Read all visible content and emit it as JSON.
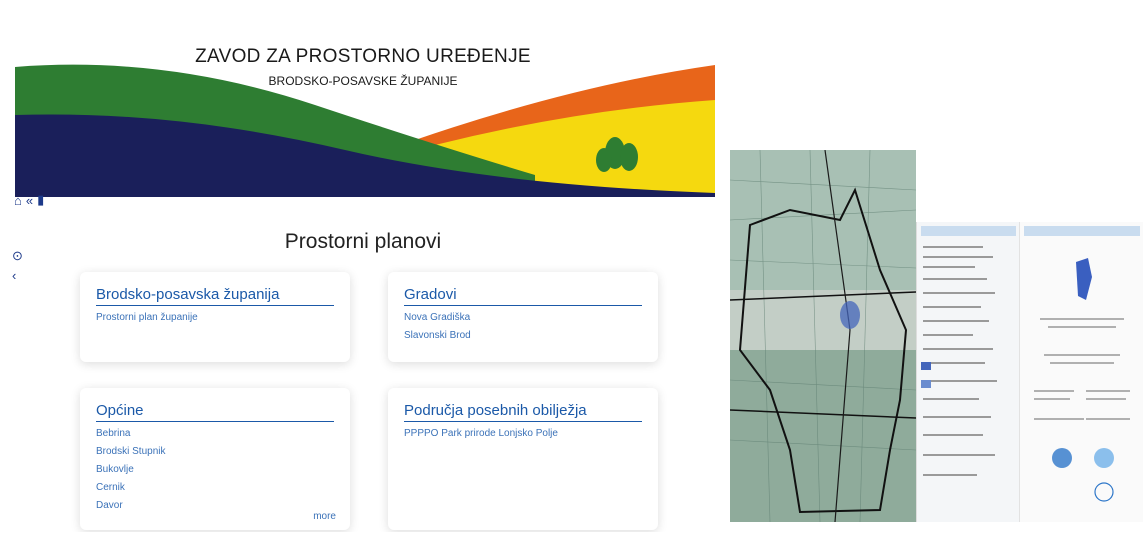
{
  "header": {
    "title": "ZAVOD ZA PROSTORNO UREĐENJE",
    "subtitle": "BRODSKO-POSAVSKE ŽUPANIJE"
  },
  "nav": {
    "home_icon": "home-icon",
    "back_icon": "double-chevron-left-icon",
    "book_icon": "book-icon"
  },
  "side_tools": {
    "up_icon": "chevron-up-circle-icon",
    "share_icon": "share-icon"
  },
  "page_title": "Prostorni planovi",
  "cards": {
    "county": {
      "title": "Brodsko-posavska županija",
      "items": [
        "Prostorni plan županije"
      ]
    },
    "cities": {
      "title": "Gradovi",
      "items": [
        "Nova Gradiška",
        "Slavonski Brod"
      ]
    },
    "municipalities": {
      "title": "Općine",
      "items": [
        "Bebrina",
        "Brodski Stupnik",
        "Bukovlje",
        "Cernik",
        "Davor"
      ],
      "more": "more"
    },
    "special": {
      "title": "Područja posebnih obilježja",
      "items": [
        "PPPPO Park prirode Lonjsko Polje"
      ]
    }
  },
  "colors": {
    "accent_blue": "#1b59a8",
    "banner_green": "#2e7d32",
    "banner_navy": "#1a1f5a",
    "banner_orange": "#e8651a",
    "banner_yellow": "#f5d90f"
  }
}
